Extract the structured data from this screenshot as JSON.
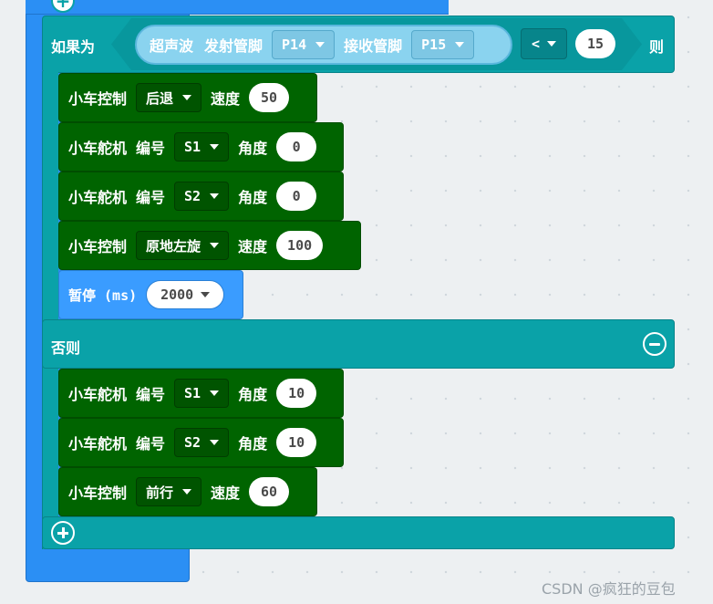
{
  "if_block": {
    "if_label": "如果为",
    "then_label": "则",
    "else_label": "否则",
    "ultrasonic": {
      "label": "超声波",
      "trig_label": "发射管脚",
      "trig_pin": "P14",
      "echo_label": "接收管脚",
      "echo_pin": "P15"
    },
    "compare_op": "<",
    "compare_value": "15"
  },
  "then_blocks": [
    {
      "title": "小车控制",
      "option": "后退",
      "param_label": "速度",
      "value": "50"
    },
    {
      "title": "小车舵机",
      "num_label": "编号",
      "servo": "S1",
      "param_label": "角度",
      "value": "0"
    },
    {
      "title": "小车舵机",
      "num_label": "编号",
      "servo": "S2",
      "param_label": "角度",
      "value": "0"
    },
    {
      "title": "小车控制",
      "option": "原地左旋",
      "param_label": "速度",
      "value": "100"
    }
  ],
  "pause": {
    "label": "暂停 (ms)",
    "value": "2000"
  },
  "else_blocks": [
    {
      "title": "小车舵机",
      "num_label": "编号",
      "servo": "S1",
      "param_label": "角度",
      "value": "10"
    },
    {
      "title": "小车舵机",
      "num_label": "编号",
      "servo": "S2",
      "param_label": "角度",
      "value": "10"
    },
    {
      "title": "小车控制",
      "option": "前行",
      "param_label": "速度",
      "value": "60"
    }
  ],
  "icons": {
    "add": "plus-circle-icon",
    "remove": "minus-circle-icon",
    "dropdown": "caret-down-icon"
  },
  "colors": {
    "background": "#edf0f2",
    "loop_blue": "#2b8ff4",
    "if_teal": "#0aa2a8",
    "car_green": "#006400",
    "pause_blue": "#3a9cff"
  },
  "watermark": "CSDN @疯狂的豆包"
}
